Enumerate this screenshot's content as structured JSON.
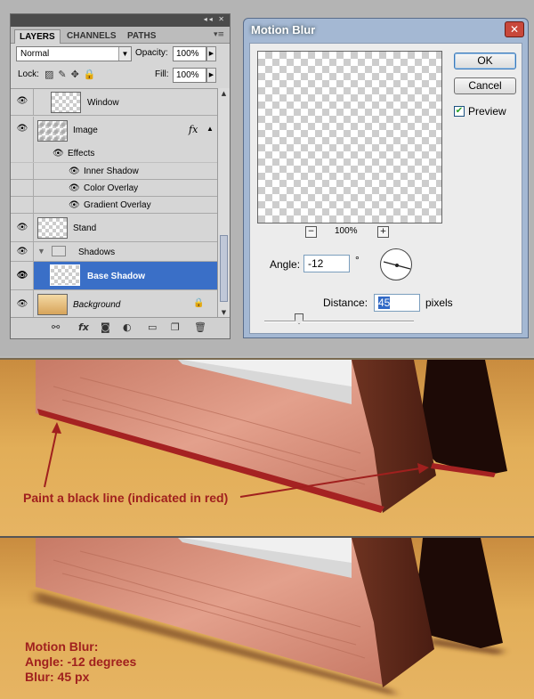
{
  "layers_panel": {
    "tabs": [
      "LAYERS",
      "CHANNELS",
      "PATHS"
    ],
    "blend_mode": "Normal",
    "opacity_label": "Opacity:",
    "opacity_value": "100%",
    "lock_label": "Lock:",
    "fill_label": "Fill:",
    "fill_value": "100%",
    "layers": [
      {
        "name": "Window"
      },
      {
        "name": "Image",
        "fx": "fx"
      },
      {
        "name": "Effects"
      },
      {
        "name": "Inner Shadow"
      },
      {
        "name": "Color Overlay"
      },
      {
        "name": "Gradient Overlay"
      },
      {
        "name": "Stand"
      },
      {
        "name": "Shadows"
      },
      {
        "name": "Base Shadow",
        "selected": true
      },
      {
        "name": "Background"
      }
    ]
  },
  "motion_blur": {
    "title": "Motion Blur",
    "ok_label": "OK",
    "cancel_label": "Cancel",
    "preview_label": "Preview",
    "preview_checked": true,
    "zoom": "100%",
    "angle_label": "Angle:",
    "angle_value": "-12",
    "angle_unit": "°",
    "distance_label": "Distance:",
    "distance_value": "45",
    "distance_unit": "pixels"
  },
  "annotations": {
    "scene1": "Paint a black line (indicated in red)",
    "scene2_lines": [
      "Motion Blur:",
      "Angle: -12 degrees",
      "Blur: 45 px"
    ]
  },
  "colors": {
    "selection": "#3a6fc7",
    "annotation": "#a0201e",
    "table": "#e2ae58",
    "frame_wood": "#d88e7a"
  }
}
